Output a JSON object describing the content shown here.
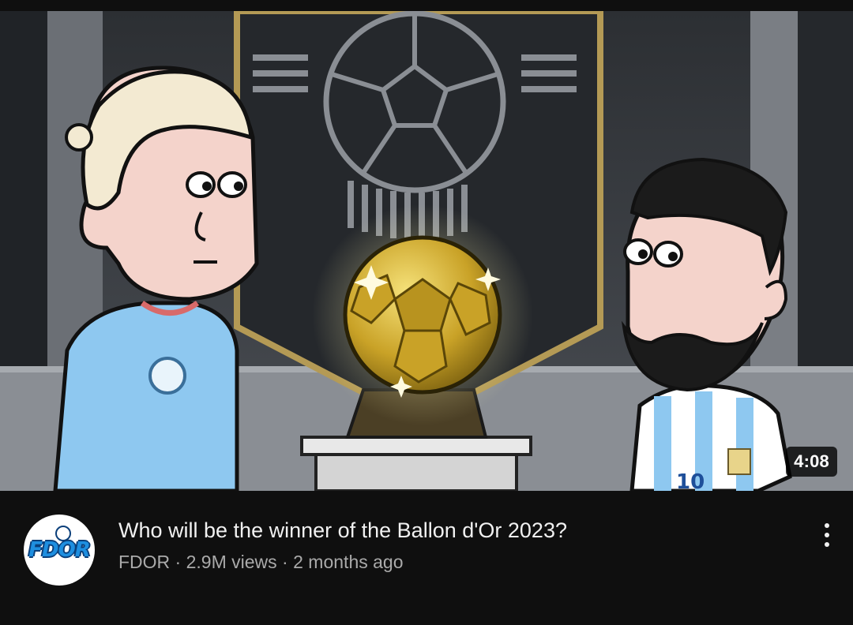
{
  "video": {
    "duration": "4:08",
    "title": "Who will be the winner of the Ballon d'Or 2023?",
    "channel": "FDOR",
    "views": "2.9M views",
    "age": "2 months ago",
    "separator": " · "
  },
  "channel_avatar": {
    "text": "FDOR",
    "brand_color": "#1e8fe0"
  },
  "thumbnail": {
    "jersey_number": "10"
  },
  "icons": {
    "more": "more-vert-icon"
  }
}
